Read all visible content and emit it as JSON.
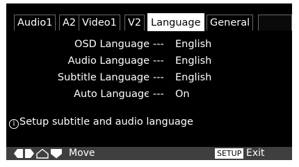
{
  "tabs": [
    {
      "label": "Audio1"
    },
    {
      "label": "A2"
    },
    {
      "label": "Video1"
    },
    {
      "label": "V2"
    },
    {
      "label": "Language"
    },
    {
      "label": "General"
    }
  ],
  "settings": [
    {
      "label": "OSD Language",
      "separator": "---",
      "value": "English"
    },
    {
      "label": "Audio Language",
      "separator": "---",
      "value": "English"
    },
    {
      "label": "Subtitle Language",
      "separator": "---",
      "value": "English"
    },
    {
      "label": "Auto Languagє",
      "separator": "---",
      "value": "On"
    }
  ],
  "hint": {
    "icon": "info-icon",
    "text": "Setup subtitle and audio language"
  },
  "footer": {
    "nav_icons": [
      "left-arrow-icon",
      "right-arrow-icon",
      "up-arrow-icon",
      "down-arrow-icon"
    ],
    "move_label": "Move",
    "setup_key": "SETUP",
    "exit_label": "Exit"
  },
  "colors": {
    "background": "#000000",
    "active_tab": "#ffffff",
    "footer_bar": "#3f3f3f",
    "text": "#ffffff"
  }
}
